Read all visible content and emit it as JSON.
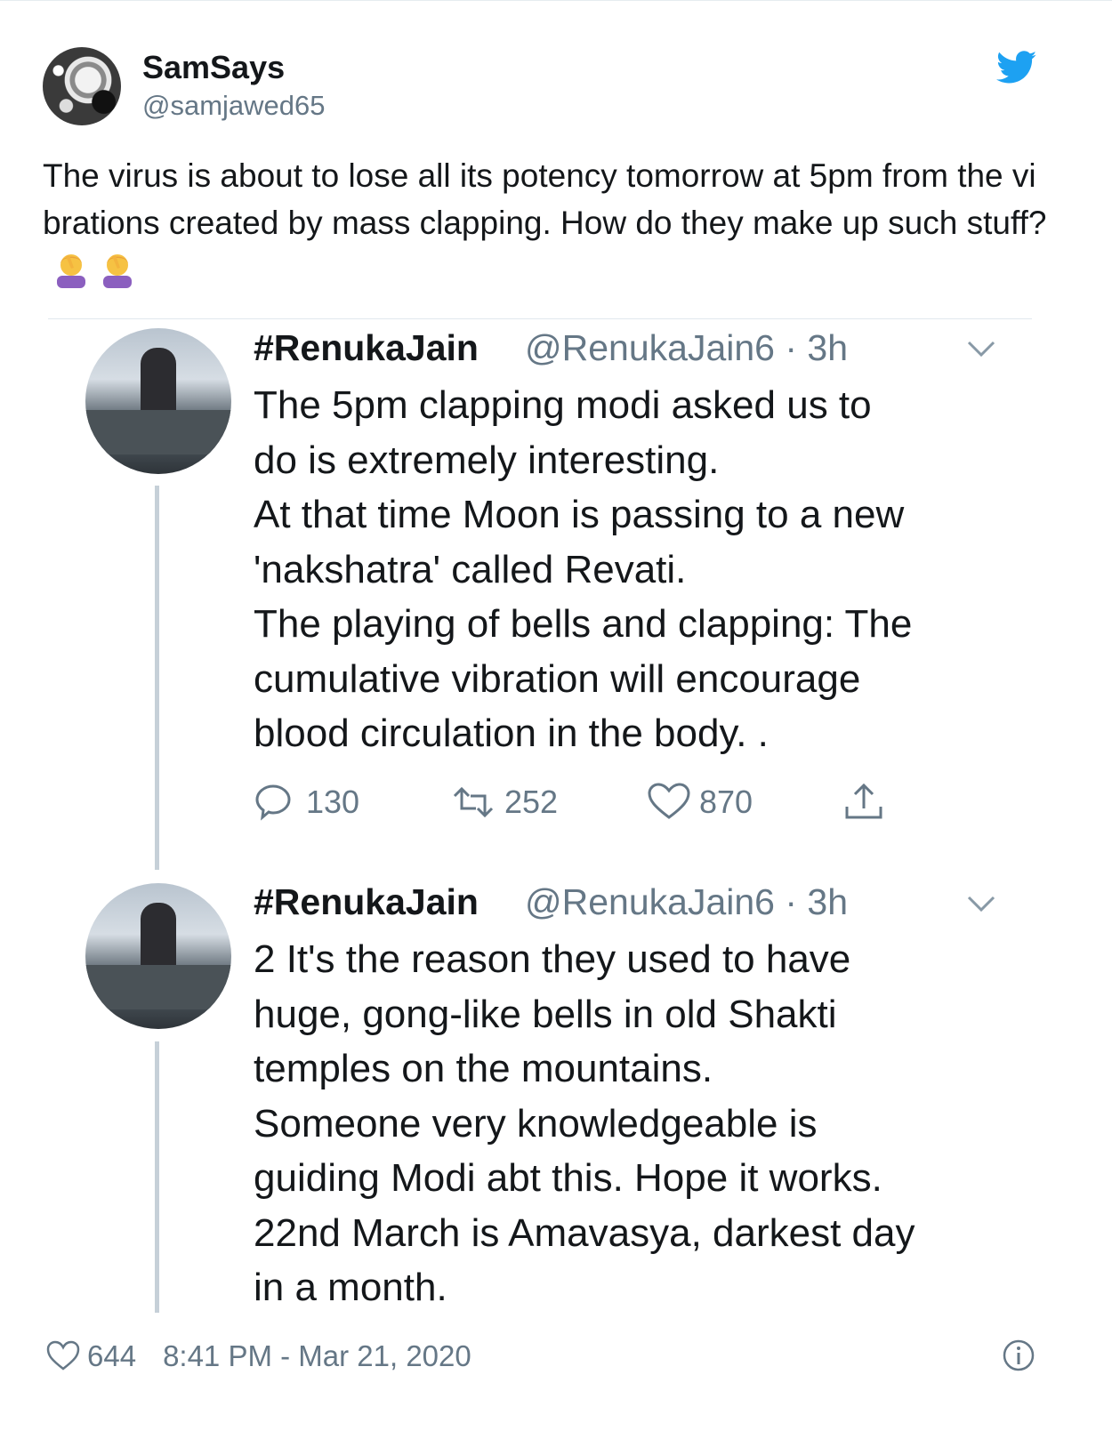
{
  "tweet": {
    "display_name": "SamSays",
    "handle": "@samjawed65",
    "text": "The virus is about to lose all its potency tomorrow at 5pm from the vibrations created by mass clapping. How do they make up such stuff?",
    "emoji": [
      "facepalm-emoji",
      "facepalm-emoji"
    ],
    "like_count": "644",
    "timestamp": "8:41 PM - Mar 21, 2020",
    "brand_color": "#1da1f2"
  },
  "quoted": [
    {
      "name": "#RenukaJain",
      "handle_time": "@RenukaJain6 · 3h",
      "text": "The 5pm clapping  modi asked us to\ndo is extremely interesting.\nAt that time Moon is passing to a new\n'nakshatra' called Revati.\nThe playing of bells and clapping: The\ncumulative vibration will encourage\nblood circulation in the body. .",
      "replies": "130",
      "retweets": "252",
      "likes": "870"
    },
    {
      "name": "#RenukaJain",
      "handle_time": "@RenukaJain6 · 3h",
      "text": "2 It's the reason they used to have\nhuge, gong-like bells in old Shakti\ntemples on the mountains.\nSomeone very knowledgeable is\nguiding Modi abt this. Hope it works.\n22nd March is Amavasya, darkest day\nin a month."
    }
  ]
}
